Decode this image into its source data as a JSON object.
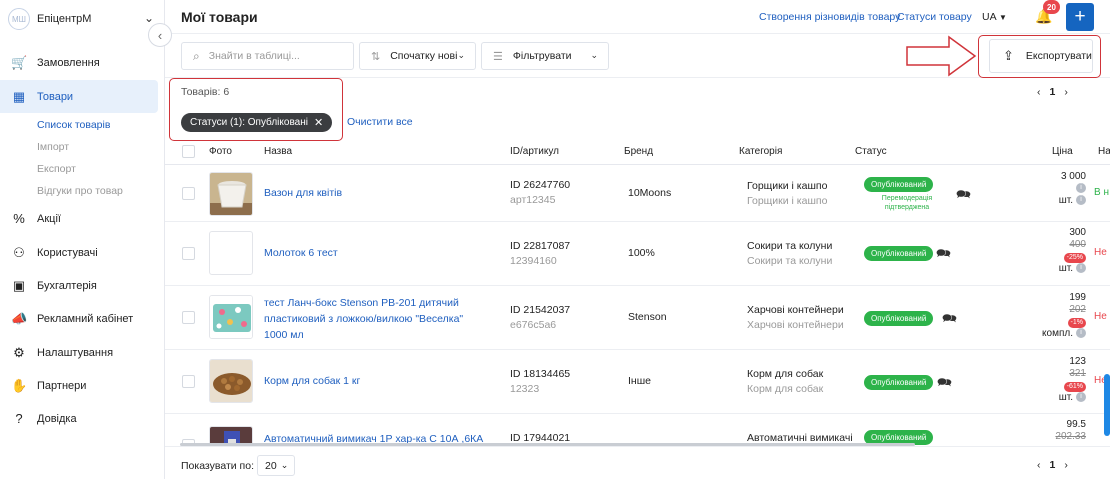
{
  "sidebar": {
    "avatar": "МШ",
    "company": "ЕпіцентрМ",
    "items": [
      {
        "label": "Замовлення",
        "icon": "cart-icon"
      },
      {
        "label": "Товари",
        "icon": "product-box-icon"
      },
      {
        "label": "Акції",
        "icon": "promo-icon"
      },
      {
        "label": "Користувачі",
        "icon": "users-icon"
      },
      {
        "label": "Бухгалтерія",
        "icon": "wallet-icon"
      },
      {
        "label": "Рекламний кабінет",
        "icon": "megaphone-icon"
      },
      {
        "label": "Налаштування",
        "icon": "gear-icon"
      },
      {
        "label": "Партнери",
        "icon": "handshake-icon"
      },
      {
        "label": "Довідка",
        "icon": "help-icon"
      }
    ],
    "subitems": [
      "Список товарів",
      "Імпорт",
      "Експорт",
      "Відгуки про товар"
    ]
  },
  "header": {
    "title": "Мої товари",
    "link1": "Створення різновидів товару",
    "link2": "Статуси товару",
    "lang": "UA",
    "notifications": "20",
    "add": "+"
  },
  "toolbar": {
    "search_placeholder": "Знайти в таблиці...",
    "sort": "Спочатку нові",
    "filter": "Фільтрувати",
    "export": "Експортувати"
  },
  "summary": {
    "count": "Товарів: 6",
    "chip": "Статуси (1): Опубліковані",
    "clear": "Очистити все"
  },
  "pagination": {
    "page": "1",
    "prev": "‹",
    "next": "›"
  },
  "table": {
    "headers": [
      "Фото",
      "Назва",
      "ID/артикул",
      "Бренд",
      "Категорія",
      "Статус",
      "Ціна",
      "На"
    ],
    "rows": [
      {
        "name": "Вазон для квітів",
        "id": "ID 26247760",
        "sku": "арт12345",
        "brand": "10Moons",
        "cat": "Горщики і кашпо",
        "cat_sub": "Горщики і кашпо",
        "status": "Опублікований",
        "note": "Перемодерація підтверджена",
        "price": "3 000",
        "old": "",
        "disc": "",
        "unit": "шт.",
        "next": "В н"
      },
      {
        "name": "Молоток 6 тест",
        "id": "ID 22817087",
        "sku": "12394160",
        "brand": "100%",
        "cat": "Сокири та колуни",
        "cat_sub": "Сокири та колуни",
        "status": "Опублікований",
        "note": "",
        "price": "300",
        "old": "400",
        "disc": "-25%",
        "unit": "шт.",
        "next": "Не"
      },
      {
        "name": "тест Ланч-бокс Stenson PB-201 дитячий пластиковий з ложкою/вилкою \"Веселка\" 1000 мл",
        "id": "ID 21542037",
        "sku": "e676c5a6",
        "brand": "Stenson",
        "cat": "Харчові контейнери",
        "cat_sub": "Харчові контейнери",
        "status": "Опублікований",
        "note": "",
        "price": "199",
        "old": "202",
        "disc": "-1%",
        "unit": "компл.",
        "next": "Не"
      },
      {
        "name": "Корм для собак 1 кг",
        "id": "ID 18134465",
        "sku": "12323",
        "brand": "Інше",
        "cat": "Корм для собак",
        "cat_sub": "Корм для собак",
        "status": "Опублікований",
        "note": "",
        "price": "123",
        "old": "321",
        "disc": "-61%",
        "unit": "шт.",
        "next": "Не"
      },
      {
        "name": "Автоматичний вимикач 1Р хар-ка С 10А ,6КА",
        "id": "ID 17944021",
        "sku": "",
        "brand": "",
        "cat": "Автоматичні вимикачі",
        "cat_sub": "",
        "status": "Опублікований",
        "note": "",
        "price": "99.5",
        "old": "202.33",
        "disc": "",
        "unit": "",
        "next": ""
      }
    ]
  },
  "footer": {
    "per_page_label": "Показувати по:",
    "per_page": "20"
  },
  "colors": {
    "accent": "#1565c0",
    "status": "#2db34a",
    "highlight": "#d0343a",
    "discount": "#e8474d"
  }
}
